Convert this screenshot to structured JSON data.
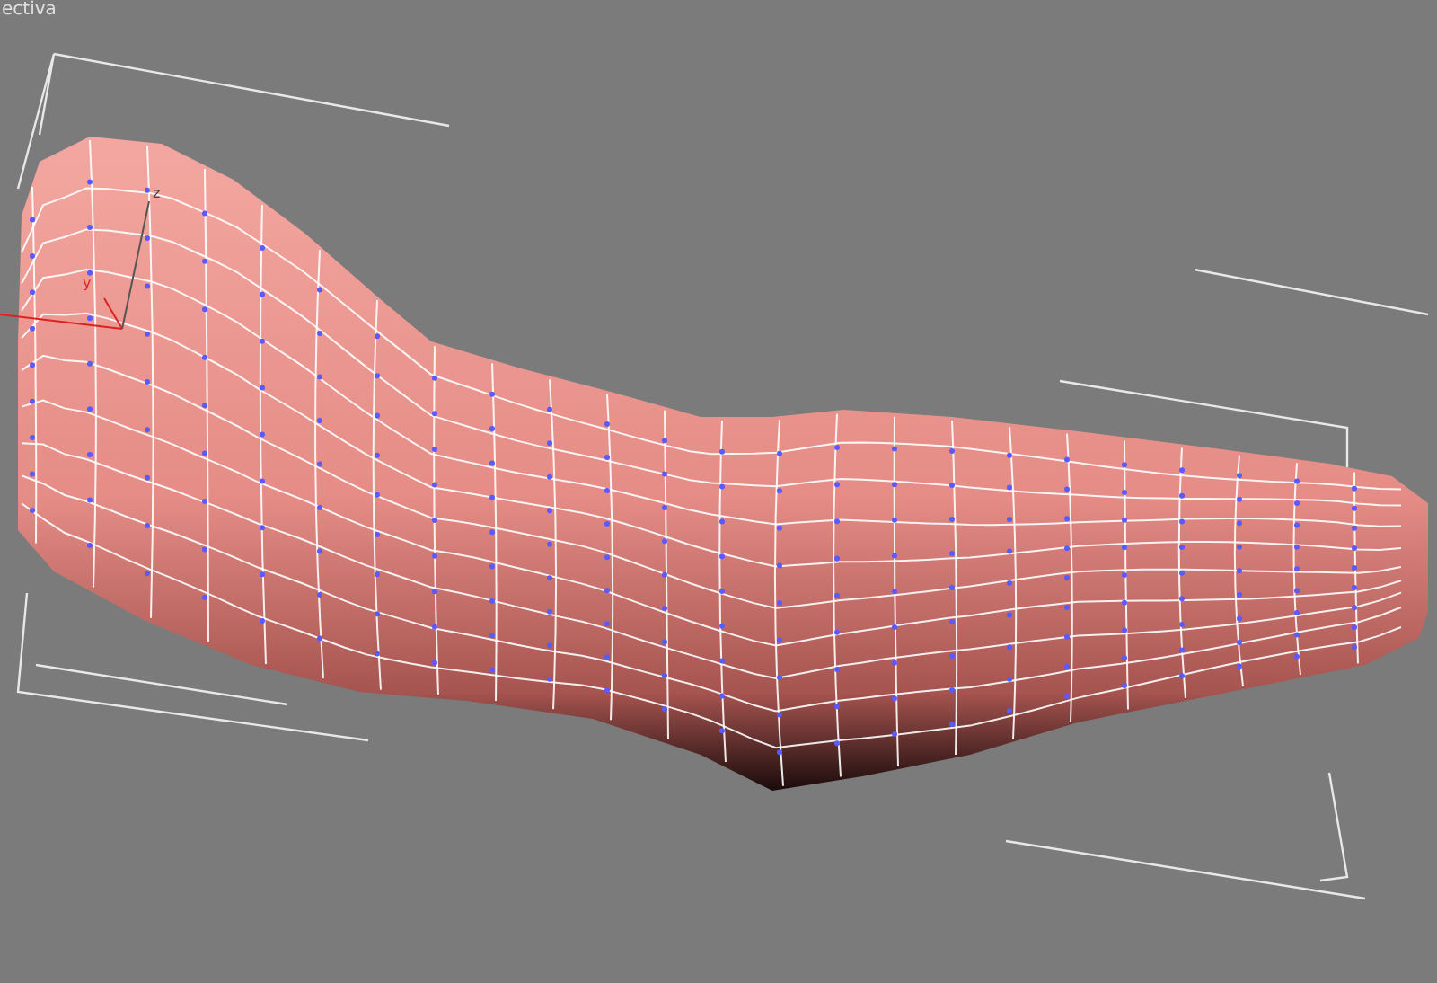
{
  "viewport": {
    "label": "ectiva",
    "gizmo_axes": [
      "z",
      "y"
    ]
  }
}
